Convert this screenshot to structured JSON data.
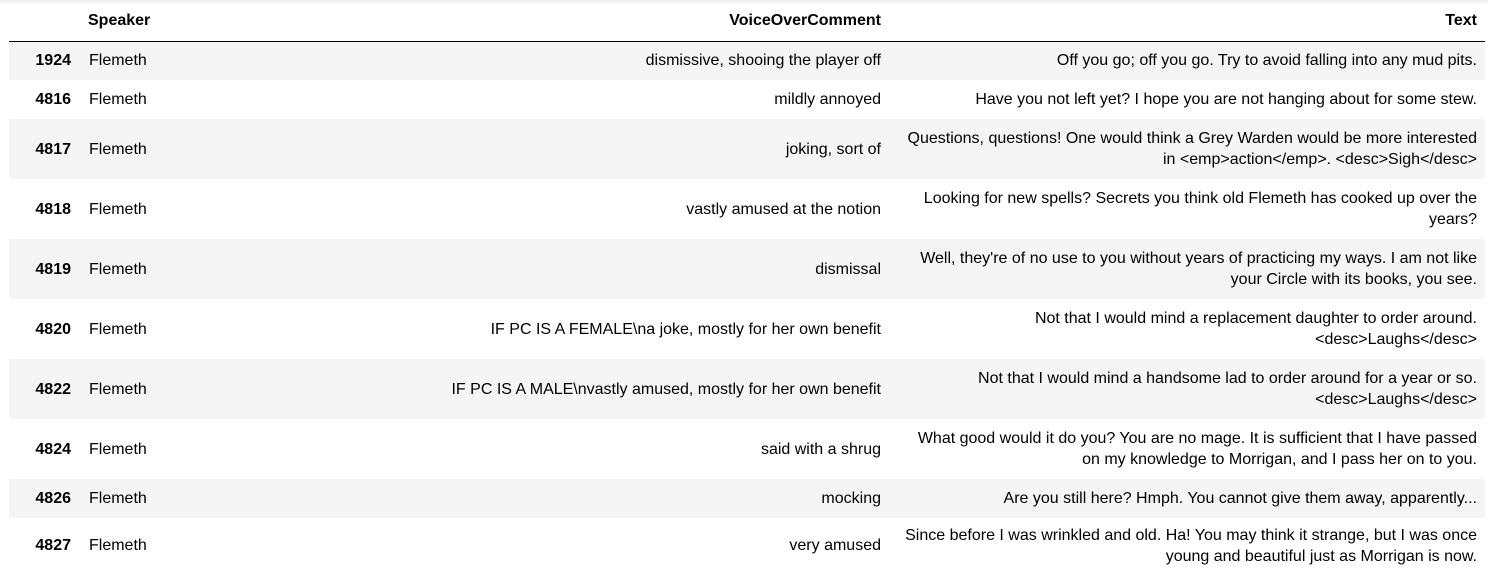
{
  "table": {
    "columns": [
      "",
      "Speaker",
      "VoiceOverComment",
      "Text"
    ],
    "rows": [
      {
        "index": "1924",
        "speaker": "Flemeth",
        "comment": "dismissive, shooing the player off",
        "text": "Off you go; off you go. Try to avoid falling into any mud pits."
      },
      {
        "index": "4816",
        "speaker": "Flemeth",
        "comment": "mildly annoyed",
        "text": "Have you not left yet? I hope you are not hanging about for some stew."
      },
      {
        "index": "4817",
        "speaker": "Flemeth",
        "comment": "joking, sort of",
        "text": "Questions, questions! One would think a Grey Warden would be more interested in <emp>action</emp>. <desc>Sigh</desc>"
      },
      {
        "index": "4818",
        "speaker": "Flemeth",
        "comment": "vastly amused at the notion",
        "text": "Looking for new spells? Secrets you think old Flemeth has cooked up over the years?"
      },
      {
        "index": "4819",
        "speaker": "Flemeth",
        "comment": "dismissal",
        "text": "Well, they're of no use to you without years of practicing my ways. I am not like your Circle with its books, you see."
      },
      {
        "index": "4820",
        "speaker": "Flemeth",
        "comment": "IF PC IS A FEMALE\\na joke, mostly for her own benefit",
        "text": "Not that I would mind a replacement daughter to order around. <desc>Laughs</desc>"
      },
      {
        "index": "4822",
        "speaker": "Flemeth",
        "comment": "IF PC IS A MALE\\nvastly amused, mostly for her own benefit",
        "text": "Not that I would mind a handsome lad to order around for a year or so. <desc>Laughs</desc>"
      },
      {
        "index": "4824",
        "speaker": "Flemeth",
        "comment": "said with a shrug",
        "text": "What good would it do you? You are no mage. It is sufficient that I have passed on my knowledge to Morrigan, and I pass her on to you."
      },
      {
        "index": "4826",
        "speaker": "Flemeth",
        "comment": "mocking",
        "text": "Are you still here? Hmph. You cannot give them away, apparently..."
      },
      {
        "index": "4827",
        "speaker": "Flemeth",
        "comment": "very amused",
        "text": "Since before I was wrinkled and old. Ha! You may think it strange, but I was once young and beautiful just as Morrigan is now."
      }
    ]
  }
}
